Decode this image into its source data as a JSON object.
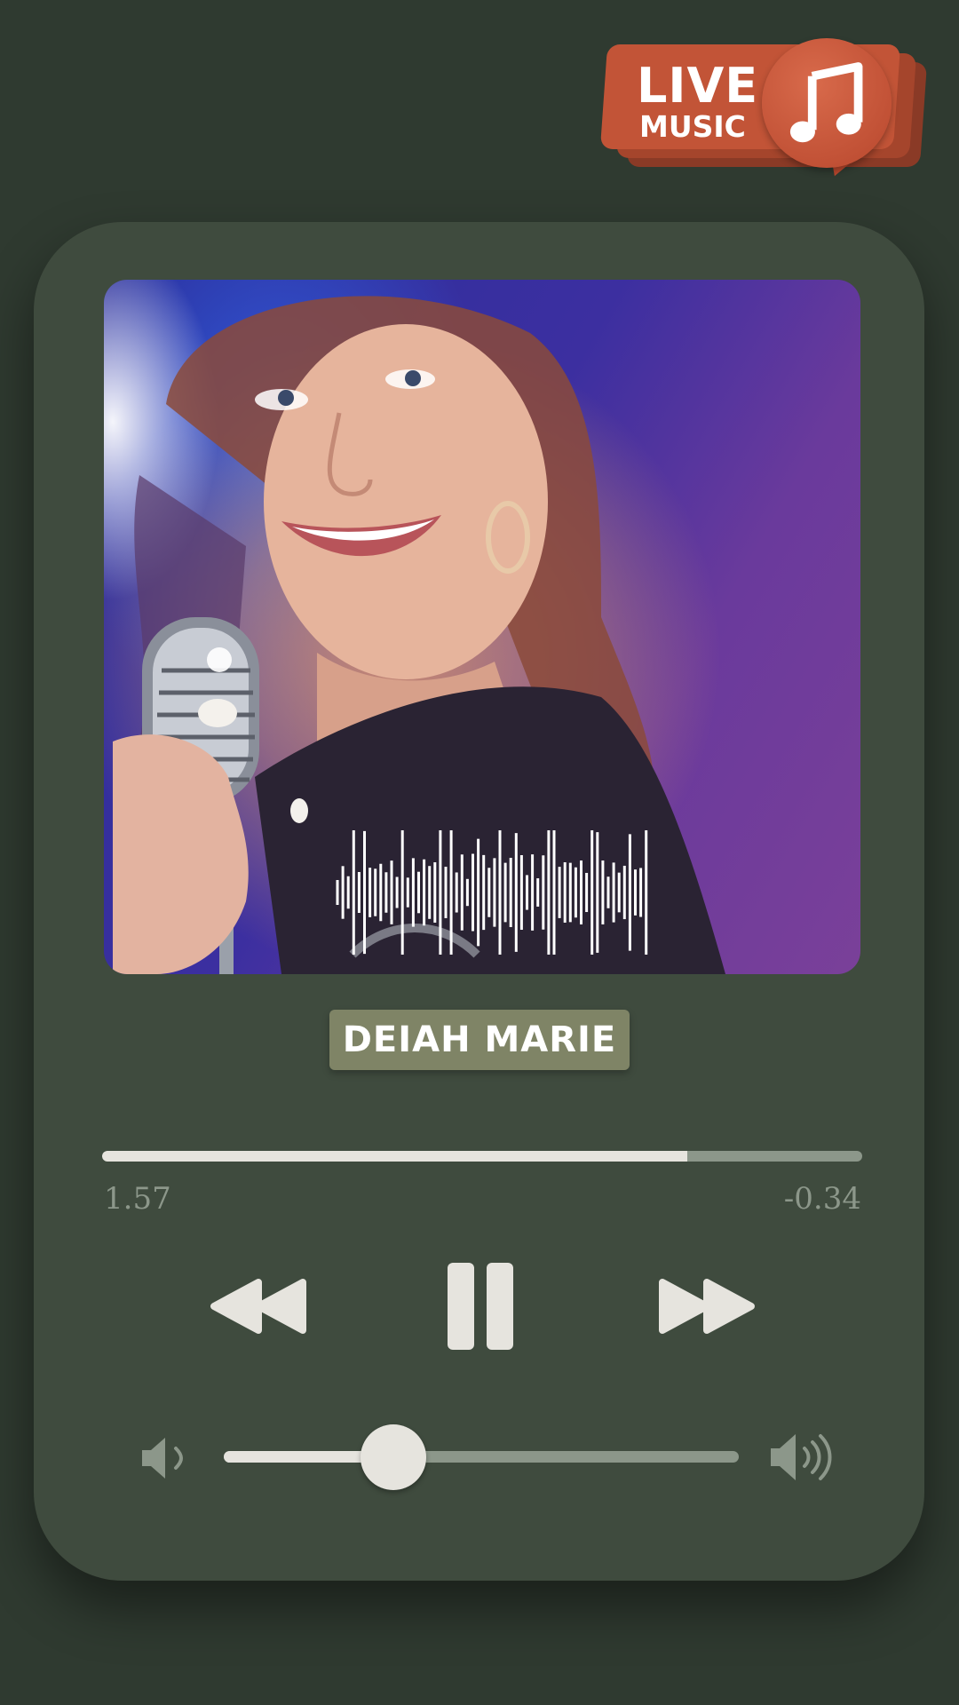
{
  "badge": {
    "line1": "LIVE",
    "line2": "MUSIC",
    "icon": "music-note-icon",
    "color": "#c25437"
  },
  "player": {
    "artist": "DEIAH MARIE",
    "progress": 0.77,
    "elapsed": "1.57",
    "remaining": "-0.34",
    "volume": 0.33,
    "controls": {
      "rewind_icon": "rewind-icon",
      "pause_icon": "pause-icon",
      "forward_icon": "fast-forward-icon",
      "volume_low_icon": "volume-low-icon",
      "volume_high_icon": "volume-high-icon"
    },
    "colors": {
      "background": "#2f3a30",
      "card": "#3f4b3e",
      "accent": "#e6e4de",
      "muted": "#8c978a",
      "tag": "#7f8466"
    }
  }
}
